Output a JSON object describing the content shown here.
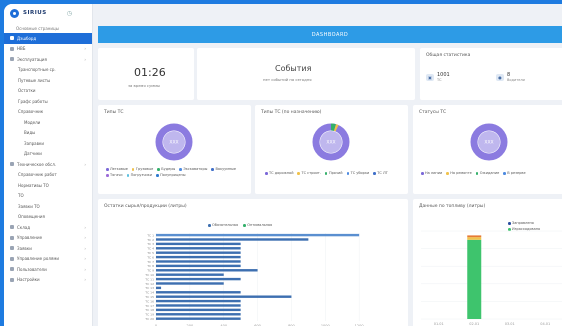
{
  "sidebar": {
    "logo": "SIRIUS",
    "top_label": "Основные страницы",
    "items": [
      {
        "label": "Дэшборд",
        "level": 0,
        "active": true
      },
      {
        "label": "НВБ",
        "level": 0
      },
      {
        "label": "Эксплуатация",
        "level": 0
      },
      {
        "label": "Транспортные ср.",
        "level": 1
      },
      {
        "label": "Путевые листы",
        "level": 1
      },
      {
        "label": "Остатки",
        "level": 1
      },
      {
        "label": "Графс работы",
        "level": 1
      },
      {
        "label": "Справочник",
        "level": 1
      },
      {
        "label": "Модели",
        "level": 2
      },
      {
        "label": "Виды",
        "level": 2
      },
      {
        "label": "Заправки",
        "level": 2
      },
      {
        "label": "Датчики",
        "level": 2
      },
      {
        "label": "Техническое обсл.",
        "level": 0
      },
      {
        "label": "Справочник работ",
        "level": 1
      },
      {
        "label": "Нормативы ТО",
        "level": 1
      },
      {
        "label": "ТО",
        "level": 1
      },
      {
        "label": "Заявки ТО",
        "level": 1
      },
      {
        "label": "Оповещения",
        "level": 1
      },
      {
        "label": "Склад",
        "level": 0
      },
      {
        "label": "Управление",
        "level": 0
      },
      {
        "label": "Заявки",
        "level": 0
      },
      {
        "label": "Управление ролями",
        "level": 0
      },
      {
        "label": "Пользователи",
        "level": 0
      },
      {
        "label": "Настройки",
        "level": 0
      }
    ]
  },
  "banner": {
    "title": "DASHBOARD"
  },
  "time_card": {
    "time": "01:26",
    "caption": "за время суммы"
  },
  "events_card": {
    "title": "События",
    "caption": "нет событий на сегодня"
  },
  "stats_card": {
    "title": "Общая статистика",
    "items": [
      {
        "icon": "truck-icon",
        "value": "1001",
        "label": "ТС"
      },
      {
        "icon": "person-icon",
        "value": "8",
        "label": "Водители"
      }
    ]
  },
  "donuts": [
    {
      "title": "Типы ТС",
      "center": "XXX",
      "legend": [
        {
          "label": "Легковые",
          "color": "#7b68d8"
        },
        {
          "label": "Грузовые",
          "color": "#f0c24b"
        },
        {
          "label": "Будеры",
          "color": "#34b06b"
        },
        {
          "label": "Экскаваторы",
          "color": "#4d8ae0"
        },
        {
          "label": "Вакуумные",
          "color": "#3f6fc9"
        },
        {
          "label": "Тягачи",
          "color": "#9c6bd8"
        },
        {
          "label": "Погрузчики",
          "color": "#5cc0e0"
        },
        {
          "label": "Полуприцепы",
          "color": "#2e7ad0"
        }
      ]
    },
    {
      "title": "Типы ТС (по назначению)",
      "center": "XXX",
      "legend": [
        {
          "label": "ТС дорожной",
          "color": "#7b68d8"
        },
        {
          "label": "ТС строит.",
          "color": "#f0c24b"
        },
        {
          "label": "Прочий",
          "color": "#34b06b"
        },
        {
          "label": "ТС уборки",
          "color": "#4d8ae0"
        },
        {
          "label": "ТС ЛТ",
          "color": "#3f6fc9"
        }
      ]
    },
    {
      "title": "Статусы ТС",
      "center": "XXX",
      "legend": [
        {
          "label": "На линии",
          "color": "#7b68d8"
        },
        {
          "label": "На ремонте",
          "color": "#f0c24b"
        },
        {
          "label": "Ожидание",
          "color": "#34b06b"
        },
        {
          "label": "В резерве",
          "color": "#4d8ae0"
        }
      ]
    }
  ],
  "chart_data": [
    {
      "type": "bar",
      "orientation": "horizontal",
      "title": "Остатки сырья/продукции (литры)",
      "series": [
        {
          "name": "Обязательная",
          "color": "#3d6fb0"
        },
        {
          "name": "Оптимальная",
          "color": "#34b06b"
        }
      ],
      "categories": [
        "ТС 1",
        "ТС 2",
        "ТС 3",
        "ТС 4",
        "ТС 5",
        "ТС 6",
        "ТС 7",
        "ТС 8",
        "ТС 9",
        "ТС 10",
        "ТС 11",
        "ТС 12",
        "ТС 13",
        "ТС 14",
        "ТС 15",
        "ТС 16",
        "ТС 17",
        "ТС 18",
        "ТС 19",
        "ТС 20"
      ],
      "values": [
        1200,
        900,
        500,
        500,
        500,
        500,
        500,
        500,
        600,
        400,
        500,
        400,
        30,
        500,
        800,
        500,
        500,
        500,
        500,
        500
      ],
      "x_ticks": [
        "0",
        "200",
        "400",
        "600",
        "800",
        "1000",
        "1200"
      ],
      "xlim": [
        0,
        1400
      ]
    },
    {
      "type": "bar",
      "title": "Данные по топливу (литры)",
      "series": [
        {
          "name": "Заправлено",
          "color": "#2b4ea0"
        },
        {
          "name": "Израсходовано",
          "color": "#3ec46d"
        }
      ],
      "categories": [
        "01.01",
        "02.01",
        "03.01",
        "04.01"
      ],
      "stacked": [
        {
          "category": "02.01",
          "segments": [
            {
              "value": 90,
              "color": "#3ec46d"
            },
            {
              "value": 3,
              "color": "#f0c24b"
            },
            {
              "value": 2,
              "color": "#e67a35"
            }
          ]
        }
      ],
      "ylim": [
        0,
        100
      ]
    }
  ]
}
